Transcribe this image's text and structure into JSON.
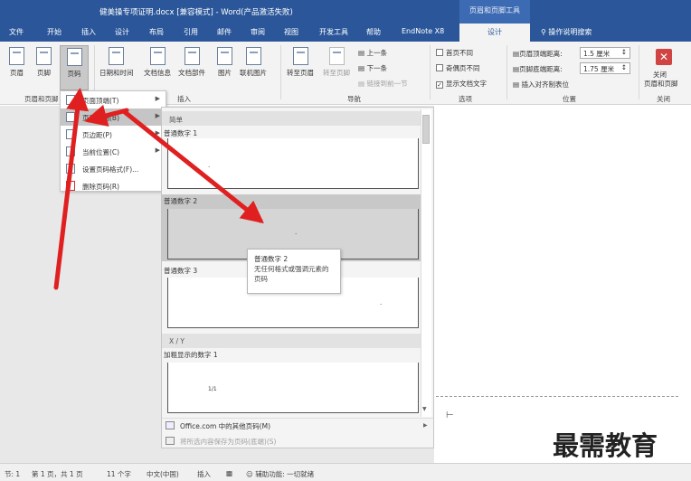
{
  "title_bar": {
    "document_title": "健美操专项证明.docx [兼容模式] - Word(产品激活失败)",
    "context_tab_header": "页眉和页脚工具"
  },
  "tabs": [
    "文件",
    "开始",
    "插入",
    "设计",
    "布局",
    "引用",
    "邮件",
    "审阅",
    "视图",
    "开发工具",
    "帮助",
    "EndNote X8"
  ],
  "active_tab": "设计",
  "help_search": "操作说明搜索",
  "ribbon": {
    "header_label": "页眉",
    "footer_label": "页脚",
    "page_number_label": "页码",
    "datetime_label": "日期和时间",
    "docinfo_label": "文档信息",
    "docparts_label": "文档部件",
    "picture_label": "图片",
    "online_picture_label": "联机图片",
    "goto_header_label": "转至页眉",
    "goto_footer_label": "转至页脚",
    "prev_label": "上一条",
    "next_label": "下一条",
    "link_prev_label": "链接到前一节",
    "diff_first_label": "首页不同",
    "diff_odd_even_label": "奇偶页不同",
    "show_text_label": "显示文档文字",
    "header_top_label": "页眉顶端距离:",
    "header_top_value": "1.5 厘米",
    "footer_bottom_label": "页脚底端距离:",
    "footer_bottom_value": "1.75 厘米",
    "insert_align_tab_label": "插入对齐制表位",
    "close_label_1": "关闭",
    "close_label_2": "页眉和页脚",
    "group_hf": "页眉和页脚",
    "group_insert": "插入",
    "group_nav": "导航",
    "group_options": "选项",
    "group_position": "位置",
    "group_close": "关闭"
  },
  "page_number_menu": [
    {
      "label": "页面顶端(T)",
      "has_sub": true
    },
    {
      "label": "页面底端(B)",
      "has_sub": true
    },
    {
      "label": "页边距(P)",
      "has_sub": true
    },
    {
      "label": "当前位置(C)",
      "has_sub": true
    },
    {
      "label": "设置页码格式(F)...",
      "has_sub": false
    },
    {
      "label": "删除页码(R)",
      "has_sub": false
    }
  ],
  "gallery": {
    "section_simple": "简单",
    "item1": "普通数字 1",
    "item2": "普通数字 2",
    "item3": "普通数字 3",
    "section_xy": "X / Y",
    "item4": "加粗显示的数字 1",
    "item4_preview": "1/1",
    "more_label": "Office.com 中的其他页码(M)",
    "save_label": "将所选内容保存为页码(底端)(S)"
  },
  "tooltip": {
    "title": "普通数字 2",
    "desc": "无任何格式或强调元素的页码"
  },
  "status_bar": {
    "section": "节: 1",
    "page": "第 1 页，共 1 页",
    "words": "11 个字",
    "language": "中文(中国)",
    "mode": "插入",
    "accessibility": "辅助功能: 一切就绪"
  },
  "watermark": "最需教育",
  "colors": {
    "title_bar": "#2b579a",
    "arrow": "#e02020",
    "close_button": "#d04444"
  }
}
